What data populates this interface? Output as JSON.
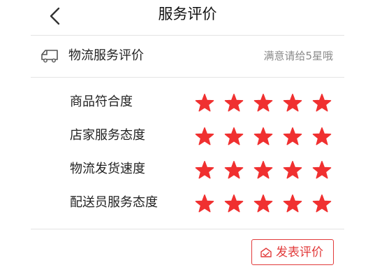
{
  "header": {
    "back_icon": "chevron-left-icon",
    "title": "服务评价"
  },
  "section": {
    "icon": "truck-icon",
    "title": "物流服务评价",
    "hint": "满意请给5星哦"
  },
  "ratings": [
    {
      "label": "商品符合度",
      "stars": 5,
      "max": 5
    },
    {
      "label": "店家服务态度",
      "stars": 5,
      "max": 5
    },
    {
      "label": "物流发货速度",
      "stars": 5,
      "max": 5
    },
    {
      "label": "配送员服务态度",
      "stars": 5,
      "max": 5
    }
  ],
  "submit": {
    "icon": "edit-box-icon",
    "label": "发表评价"
  },
  "colors": {
    "accent": "#e23a3a",
    "star": "#f03030",
    "hint": "#8a8a8a",
    "divider": "#e4e4e4"
  }
}
